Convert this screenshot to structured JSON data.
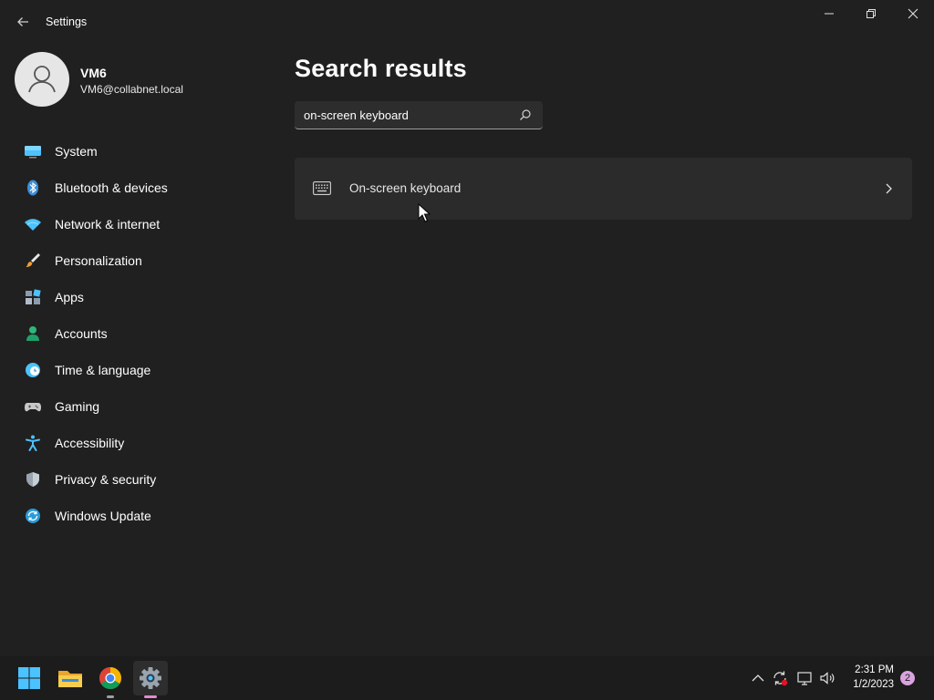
{
  "window": {
    "title": "Settings",
    "back_glyph": "←",
    "controls": [
      "minimize",
      "maximize",
      "close"
    ]
  },
  "user": {
    "name": "VM6",
    "email": "VM6@collabnet.local"
  },
  "nav": {
    "items": [
      {
        "label": "System",
        "icon": "monitor-icon"
      },
      {
        "label": "Bluetooth & devices",
        "icon": "bluetooth-icon"
      },
      {
        "label": "Network & internet",
        "icon": "wifi-icon"
      },
      {
        "label": "Personalization",
        "icon": "brush-icon"
      },
      {
        "label": "Apps",
        "icon": "apps-icon"
      },
      {
        "label": "Accounts",
        "icon": "person-icon"
      },
      {
        "label": "Time & language",
        "icon": "clock-globe-icon"
      },
      {
        "label": "Gaming",
        "icon": "gamepad-icon"
      },
      {
        "label": "Accessibility",
        "icon": "accessibility-icon"
      },
      {
        "label": "Privacy & security",
        "icon": "shield-icon"
      },
      {
        "label": "Windows Update",
        "icon": "update-icon"
      }
    ]
  },
  "main": {
    "title": "Search results",
    "search": {
      "value": "on-screen keyboard",
      "placeholder": ""
    },
    "results": [
      {
        "label": "On-screen keyboard",
        "icon": "keyboard-icon"
      }
    ]
  },
  "taskbar": {
    "apps": [
      {
        "name": "start",
        "icon": "windows-logo-icon"
      },
      {
        "name": "file-explorer",
        "icon": "folder-icon"
      },
      {
        "name": "chrome",
        "icon": "chrome-icon"
      },
      {
        "name": "settings",
        "icon": "gear-icon",
        "active": true
      }
    ],
    "time": "2:31 PM",
    "date": "1/2/2023",
    "notifications": "2"
  },
  "colors": {
    "background": "#202020",
    "card": "#2b2b2b",
    "taskbar": "#1c1c1c",
    "accent": "#4cc2ff"
  }
}
